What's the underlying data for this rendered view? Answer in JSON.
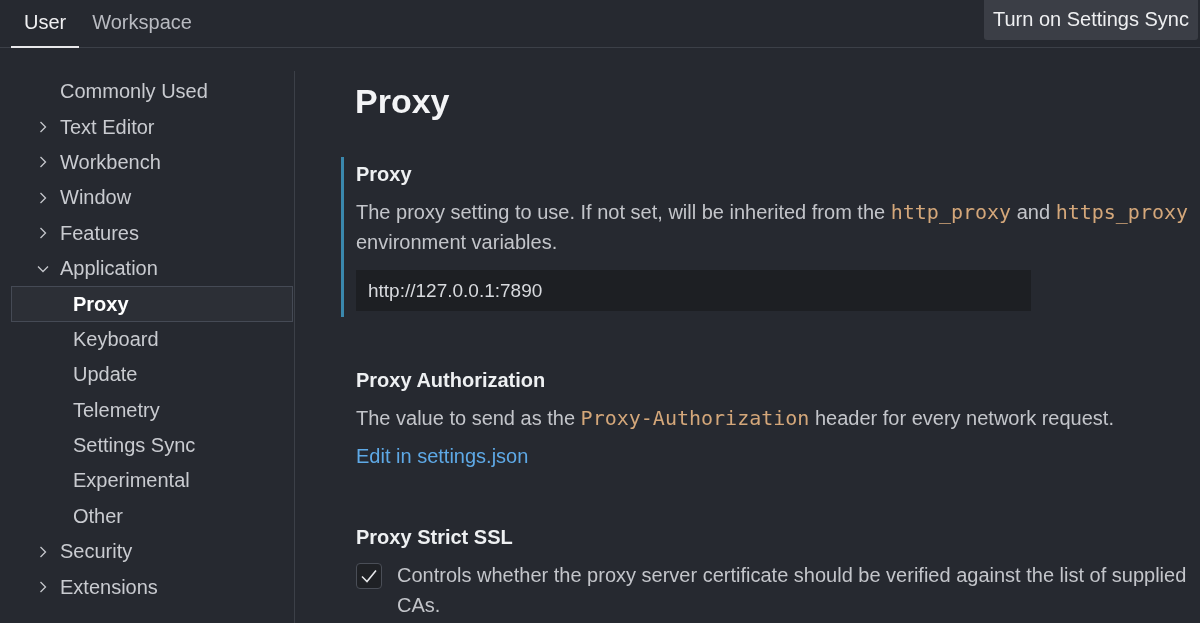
{
  "tabs": [
    {
      "label": "User",
      "selected": true
    },
    {
      "label": "Workspace",
      "selected": false
    }
  ],
  "sync_button": {
    "label": "Turn on Settings Sync"
  },
  "sidebar": {
    "items": [
      {
        "label": "Commonly Used",
        "selected": false
      },
      {
        "label": "Text Editor",
        "expanded": false,
        "selected": false
      },
      {
        "label": "Workbench",
        "expanded": false,
        "selected": false
      },
      {
        "label": "Window",
        "expanded": false,
        "selected": false
      },
      {
        "label": "Features",
        "expanded": false,
        "selected": false
      },
      {
        "label": "Application",
        "expanded": true,
        "selected": false,
        "children": [
          {
            "label": "Proxy",
            "selected": true
          },
          {
            "label": "Keyboard",
            "selected": false
          },
          {
            "label": "Update",
            "selected": false
          },
          {
            "label": "Telemetry",
            "selected": false
          },
          {
            "label": "Settings Sync",
            "selected": false
          },
          {
            "label": "Experimental",
            "selected": false
          },
          {
            "label": "Other",
            "selected": false
          }
        ]
      },
      {
        "label": "Security",
        "expanded": false,
        "selected": false
      },
      {
        "label": "Extensions",
        "expanded": false,
        "selected": false
      }
    ]
  },
  "section_title": "Proxy",
  "settings": [
    {
      "kind": "text",
      "title": "Proxy",
      "focused": true,
      "description": [
        {
          "text": "The proxy setting to use. If not set, will be inherited from the "
        },
        {
          "text": "http_proxy",
          "code": true
        },
        {
          "text": " and "
        },
        {
          "text": "https_proxy",
          "code": true
        },
        {
          "text": " environment variables."
        }
      ],
      "value": "http://127.0.0.1:7890"
    },
    {
      "kind": "link",
      "title": "Proxy Authorization",
      "focused": false,
      "description": [
        {
          "text": "The value to send as the "
        },
        {
          "text": "Proxy-Authorization",
          "code": true
        },
        {
          "text": " header for every network request."
        }
      ],
      "link": "Edit in settings.json"
    },
    {
      "kind": "checkbox",
      "title": "Proxy Strict SSL",
      "focused": false,
      "checked": true,
      "description": [
        {
          "text": "Controls whether the proxy server certificate should be verified against the list of supplied CAs."
        }
      ]
    }
  ]
}
